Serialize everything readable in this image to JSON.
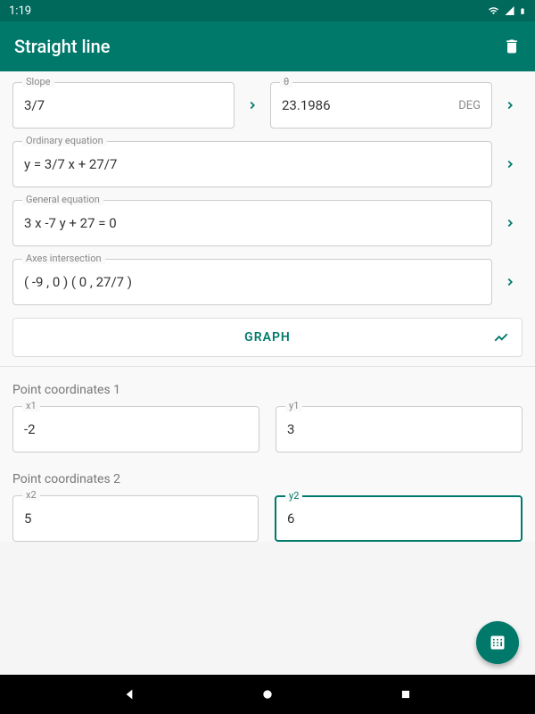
{
  "status": {
    "time": "1:19"
  },
  "header": {
    "title": "Straight line"
  },
  "fields": {
    "slope": {
      "label": "Slope",
      "value": "3/7"
    },
    "theta": {
      "label": "θ",
      "value": "23.1986",
      "unit": "DEG"
    },
    "ordinary": {
      "label": "Ordinary equation",
      "value": "y =  3/7 x  + 27/7"
    },
    "general": {
      "label": "General equation",
      "value": "3 x   -7 y + 27  = 0"
    },
    "axes": {
      "label": "Axes intersection",
      "value": "( -9 , 0 )   ( 0 , 27/7 )"
    }
  },
  "graph_button": "GRAPH",
  "point1": {
    "title": "Point coordinates 1",
    "x": {
      "label": "x1",
      "value": "-2"
    },
    "y": {
      "label": "y1",
      "value": "3"
    }
  },
  "point2": {
    "title": "Point coordinates 2",
    "x": {
      "label": "x2",
      "value": "5"
    },
    "y": {
      "label": "y2",
      "value": "6"
    }
  }
}
